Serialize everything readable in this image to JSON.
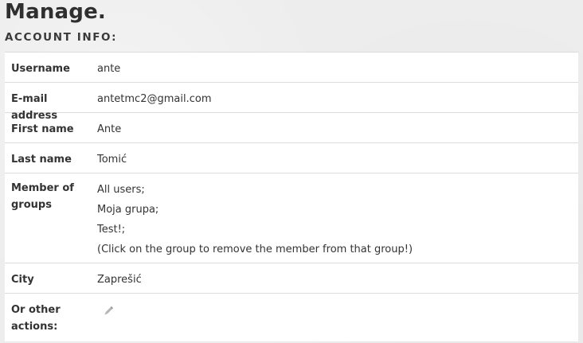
{
  "header": {
    "title": "Manage.",
    "section_title": "ACCOUNT INFO:"
  },
  "account": {
    "username": {
      "label": "Username",
      "value": "ante"
    },
    "email": {
      "label": "E-mail address",
      "value": "antetmc2@gmail.com"
    },
    "first_name": {
      "label": "First name",
      "value": "Ante"
    },
    "last_name": {
      "label": "Last name",
      "value": "Tomić"
    },
    "groups": {
      "label": "Member of groups",
      "items": [
        "All users;",
        "Moja grupa;",
        "Test!;"
      ],
      "note": "(Click on the group to remove the member from that group!)"
    },
    "city": {
      "label": "City",
      "value": "Zaprešić"
    },
    "actions": {
      "label": "Or other actions:",
      "icon": "pencil-icon"
    }
  },
  "colors": {
    "background": "#ededed",
    "table_bg": "#ffffff",
    "border": "#dcdcdc",
    "text": "#333333",
    "icon": "#b5b5b5"
  }
}
